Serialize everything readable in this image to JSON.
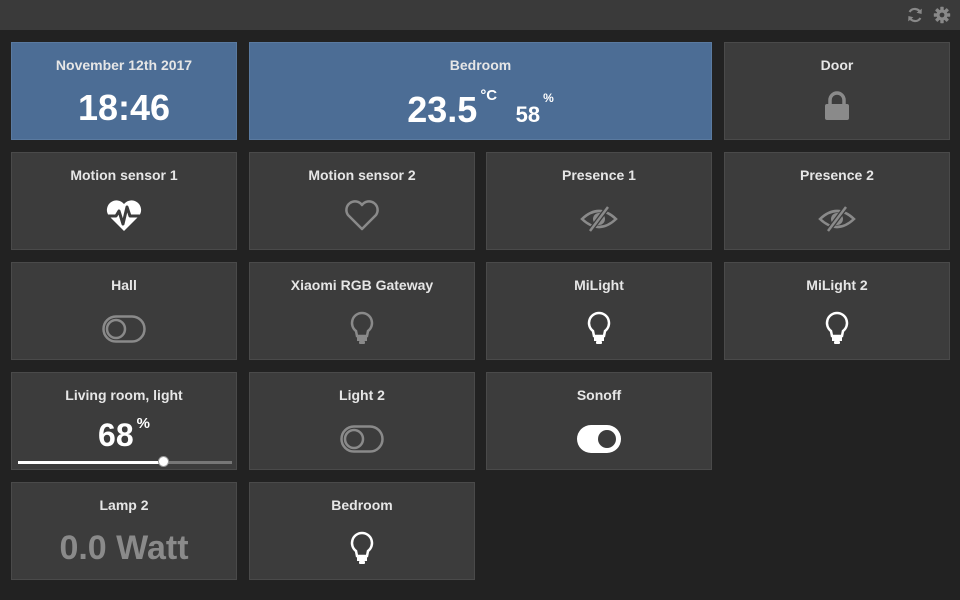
{
  "colors": {
    "background": "#222222",
    "tile": "#3c3c3c",
    "tile_active": "#4c6d95",
    "icon_active": "#ffffff",
    "icon_inactive": "#8a8a8a"
  },
  "toolbar": {
    "icons": [
      "refresh-icon",
      "gear-icon"
    ]
  },
  "tiles": {
    "date": {
      "title": "November 12th 2017",
      "time": "18:46"
    },
    "bedroom_climate": {
      "title": "Bedroom",
      "temperature": "23.5",
      "temp_unit": "°C",
      "humidity": "58",
      "humidity_unit": "%"
    },
    "door": {
      "title": "Door",
      "icon": "lock-icon"
    },
    "motion1": {
      "title": "Motion sensor 1",
      "icon": "heart-pulse-icon",
      "state": "active"
    },
    "motion2": {
      "title": "Motion sensor 2",
      "icon": "heart-outline-icon",
      "state": "inactive"
    },
    "presence1": {
      "title": "Presence 1",
      "icon": "eye-slash-icon",
      "state": "inactive"
    },
    "presence2": {
      "title": "Presence 2",
      "icon": "eye-slash-icon",
      "state": "inactive"
    },
    "hall": {
      "title": "Hall",
      "icon": "toggle-off-icon",
      "state": "off"
    },
    "gateway": {
      "title": "Xiaomi RGB Gateway",
      "icon": "bulb-icon",
      "state": "off"
    },
    "milight": {
      "title": "MiLight",
      "icon": "bulb-icon",
      "state": "on"
    },
    "milight2": {
      "title": "MiLight 2",
      "icon": "bulb-icon",
      "state": "on"
    },
    "living_room": {
      "title": "Living room, light",
      "value": "68",
      "unit": "%",
      "level": 0.68
    },
    "light2": {
      "title": "Light 2",
      "icon": "toggle-off-icon",
      "state": "off"
    },
    "sonoff": {
      "title": "Sonoff",
      "icon": "toggle-on-icon",
      "state": "on"
    },
    "lamp2": {
      "title": "Lamp 2",
      "value": "0.0 Watt"
    },
    "bedroom_light": {
      "title": "Bedroom",
      "icon": "bulb-icon",
      "state": "on"
    }
  }
}
